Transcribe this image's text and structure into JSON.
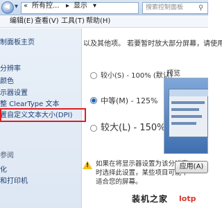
{
  "address": {
    "back_glyph": "◀",
    "forward_glyph": "▾",
    "breadcrumb_sep": "«",
    "crumb_1": "所有控...",
    "crumb_arrow_1": "▸",
    "crumb_2": "显示",
    "crumb_arrow_2": "▾",
    "search_placeholder": "搜索控制面板",
    "search_icon": "⚲"
  },
  "menu": {
    "items": [
      "编辑(E)",
      "查看(V)",
      "工具(T)",
      "帮助(H)"
    ]
  },
  "sidebar": {
    "items": [
      "制面板主页",
      "分辨率",
      "颜色",
      "示器设置",
      "整 ClearType 文本",
      "置自定义文本大小(DPI)"
    ],
    "see_also_heading": "参阅",
    "bottom_items": [
      "化",
      "和打印机"
    ]
  },
  "content": {
    "intro_line": "以及其他项。  若要暂时放大部分屏幕，请使用",
    "preview_label": "预览",
    "options": [
      {
        "label": "较小(S) - 100% (默认)",
        "selected": false
      },
      {
        "label": "中等(M) - 125%",
        "selected": true
      },
      {
        "label": "较大(L) - 150%",
        "selected": false
      }
    ],
    "warning_lines": [
      "如果在将显示器设置为该分辨率",
      "时选择此设置，某些项目可能不",
      "适合您的屏幕。"
    ],
    "apply_label": "应用(A)"
  },
  "watermark": {
    "text": "装机之家",
    "site": "lotp"
  }
}
